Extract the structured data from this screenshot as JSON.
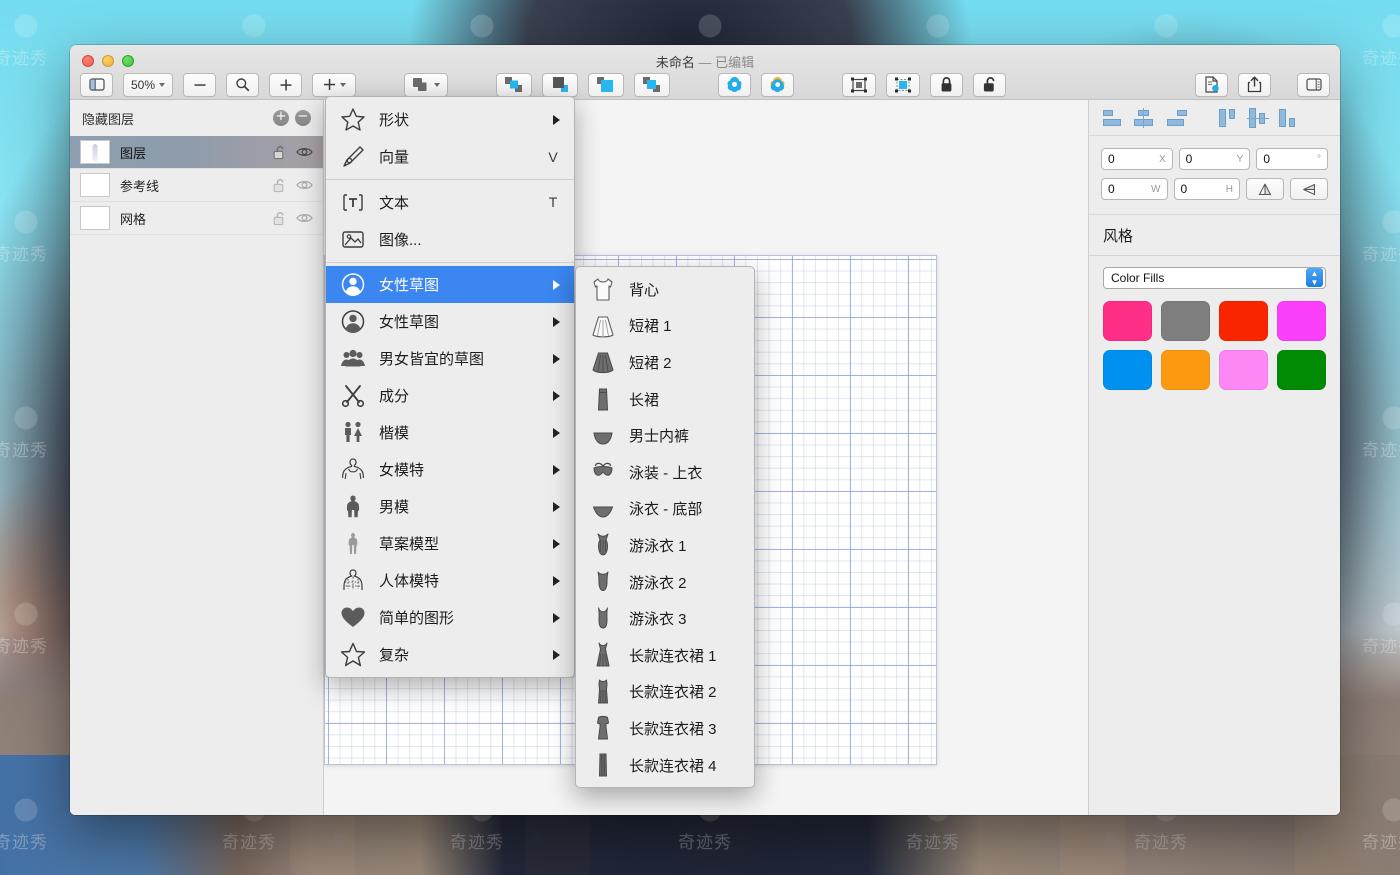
{
  "window": {
    "title_main": "未命名",
    "title_sep": "—",
    "title_state": "已编辑"
  },
  "toolbar": {
    "sidebar_toggle": "sidebar-toggle-icon",
    "zoom_value": "50%",
    "zoom_out": "−",
    "zoom_fit": "search-icon",
    "zoom_in": "+",
    "add_label": "+",
    "items": [
      {
        "name": "shape-style-button",
        "icon": "shape-style-icon"
      },
      {
        "name": "bring-forward-button",
        "icon": "bring-forward-icon"
      },
      {
        "name": "send-backward-button",
        "icon": "send-backward-icon"
      },
      {
        "name": "bring-to-front-button",
        "icon": "bring-to-front-icon"
      },
      {
        "name": "send-to-back-button",
        "icon": "send-to-back-icon"
      },
      {
        "name": "union-button",
        "icon": "flower-blue-icon"
      },
      {
        "name": "subtract-button",
        "icon": "flower-orange-icon"
      },
      {
        "name": "group-button",
        "icon": "group-icon"
      },
      {
        "name": "ungroup-button",
        "icon": "ungroup-icon"
      },
      {
        "name": "lock-button",
        "icon": "lock-closed-icon"
      },
      {
        "name": "unlock-button",
        "icon": "lock-open-icon"
      },
      {
        "name": "export-button",
        "icon": "document-export-icon"
      },
      {
        "name": "share-button",
        "icon": "share-icon"
      },
      {
        "name": "inspector-toggle",
        "icon": "inspector-toggle-icon"
      }
    ]
  },
  "sidebar": {
    "header": "隐藏图层",
    "add_button": "+",
    "remove_button": "−",
    "layers": [
      {
        "name": "图层",
        "selected": true,
        "locked": false,
        "visible": true
      },
      {
        "name": "参考线",
        "selected": false,
        "locked": false,
        "visible": false
      },
      {
        "name": "网格",
        "selected": false,
        "locked": false,
        "visible": false
      }
    ]
  },
  "menu_main": {
    "items": [
      {
        "label": "形状",
        "icon": "star-outline-icon",
        "arrow": true,
        "key": "",
        "highlight": false
      },
      {
        "label": "向量",
        "icon": "pen-tool-icon",
        "arrow": false,
        "key": "V",
        "highlight": false
      },
      {
        "separator_after": true
      },
      {
        "label": "文本",
        "icon": "text-box-icon",
        "arrow": false,
        "key": "T",
        "highlight": false
      },
      {
        "label": "图像...",
        "icon": "image-icon",
        "arrow": false,
        "key": "",
        "highlight": false
      },
      {
        "separator_after": true
      },
      {
        "label": "女性草图",
        "icon": "female-avatar-icon",
        "arrow": true,
        "key": "",
        "highlight": true
      },
      {
        "label": "女性草图",
        "icon": "male-avatar-icon",
        "arrow": true,
        "key": "",
        "highlight": false
      },
      {
        "label": "男女皆宜的草图",
        "icon": "group-people-icon",
        "arrow": true,
        "key": "",
        "highlight": false
      },
      {
        "label": "成分",
        "icon": "scissors-icon",
        "arrow": true,
        "key": "",
        "highlight": false
      },
      {
        "label": "楷模",
        "icon": "two-people-icon",
        "arrow": true,
        "key": "",
        "highlight": false
      },
      {
        "label": "女模特",
        "icon": "female-body-icon",
        "arrow": true,
        "key": "",
        "highlight": false
      },
      {
        "label": "男模",
        "icon": "male-body-icon",
        "arrow": true,
        "key": "",
        "highlight": false
      },
      {
        "label": "草案模型",
        "icon": "draft-model-icon",
        "arrow": true,
        "key": "",
        "highlight": false
      },
      {
        "label": "人体模特",
        "icon": "mannequin-icon",
        "arrow": true,
        "key": "",
        "highlight": false
      },
      {
        "label": "简单的图形",
        "icon": "heart-icon",
        "arrow": true,
        "key": "",
        "highlight": false
      },
      {
        "label": "复杂",
        "icon": "star-filled-icon",
        "arrow": true,
        "key": "",
        "highlight": false
      }
    ]
  },
  "menu_sub": {
    "items": [
      {
        "label": "背心",
        "icon": "tank-top-icon"
      },
      {
        "label": "短裙 1",
        "icon": "short-skirt-1-icon"
      },
      {
        "label": "短裙 2",
        "icon": "short-skirt-2-icon"
      },
      {
        "label": "长裙",
        "icon": "long-skirt-icon"
      },
      {
        "label": "男士内裤",
        "icon": "mens-briefs-icon"
      },
      {
        "label": "泳装 - 上衣",
        "icon": "swimsuit-top-icon"
      },
      {
        "label": "泳衣 - 底部",
        "icon": "swimsuit-bottom-icon"
      },
      {
        "label": "游泳衣 1",
        "icon": "swimsuit-1-icon"
      },
      {
        "label": "游泳衣 2",
        "icon": "swimsuit-2-icon"
      },
      {
        "label": "游泳衣 3",
        "icon": "swimsuit-3-icon"
      },
      {
        "label": "长款连衣裙 1",
        "icon": "long-dress-1-icon"
      },
      {
        "label": "长款连衣裙 2",
        "icon": "long-dress-2-icon"
      },
      {
        "label": "长款连衣裙 3",
        "icon": "long-dress-3-icon"
      },
      {
        "label": "长款连衣裙 4",
        "icon": "long-dress-4-icon"
      }
    ]
  },
  "inspector": {
    "align_icons": [
      "align-left-icon",
      "align-center-horizontal-icon",
      "align-right-icon",
      "align-top-icon",
      "align-middle-vertical-icon",
      "align-bottom-icon"
    ],
    "fields": {
      "x": {
        "value": "0",
        "unit": "X"
      },
      "y": {
        "value": "0",
        "unit": "Y"
      },
      "rotation": {
        "value": "0",
        "unit": "°"
      },
      "w": {
        "value": "0",
        "unit": "W"
      },
      "h": {
        "value": "0",
        "unit": "H"
      }
    },
    "flip_vertical": "flip-vertical-icon",
    "flip_horizontal": "flip-horizontal-icon",
    "style": {
      "title": "风格",
      "fill_select_value": "Color Fills",
      "swatches": [
        {
          "name": "swatch-pink",
          "color": "#FF2E87"
        },
        {
          "name": "swatch-gray",
          "color": "#7E7E7E"
        },
        {
          "name": "swatch-red",
          "color": "#F92500"
        },
        {
          "name": "swatch-magenta",
          "color": "#FB3FFB"
        },
        {
          "name": "swatch-blue",
          "color": "#0090F0"
        },
        {
          "name": "swatch-orange",
          "color": "#FB9A10"
        },
        {
          "name": "swatch-light-pink",
          "color": "#FE87F6"
        },
        {
          "name": "swatch-green",
          "color": "#018A03"
        }
      ]
    }
  },
  "canvas": {
    "figure_label": "male-figure-outline",
    "grid_label": "grid-background"
  },
  "watermark": {
    "text": "奇迹秀"
  }
}
